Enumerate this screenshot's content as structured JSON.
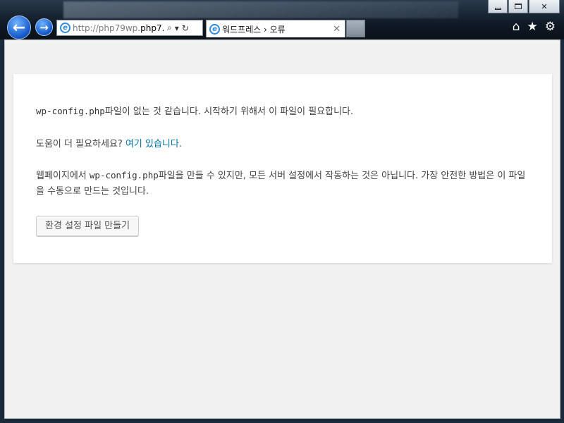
{
  "browser": {
    "address_url_prefix": "http://php79wp.",
    "address_url_main": "php7...",
    "tab_title": "워드프레스 › 오류",
    "tab_close": "✕",
    "icons": [
      "back-arrow-icon",
      "forward-arrow-icon",
      "ie-logo-icon",
      "search-icon",
      "refresh-icon",
      "home-icon",
      "favorites-star-icon",
      "settings-gear-icon"
    ]
  },
  "content": {
    "line1_code": "wp-config.php",
    "line1_text": "파일이 없는 것 같습니다. 시작하기 위해서 이 파일이 필요합니다.",
    "line2_text": "도움이 더 필요하세요? ",
    "line2_link": "여기 있습니다.",
    "line3_pre": "웹페이지에서 ",
    "line3_code": "wp-config.php",
    "line3_text": "파일을 만들 수 있지만, 모든 서버 설정에서 작동하는 것은 아닙니다. 가장 안전한 방법은 이 파일을 수동으로 만드는 것입니다.",
    "button_label": "환경 설정 파일 만들기"
  },
  "colors": {
    "link": "#0073aa",
    "page_bg": "#f1f1f1",
    "box_bg": "#ffffff"
  }
}
